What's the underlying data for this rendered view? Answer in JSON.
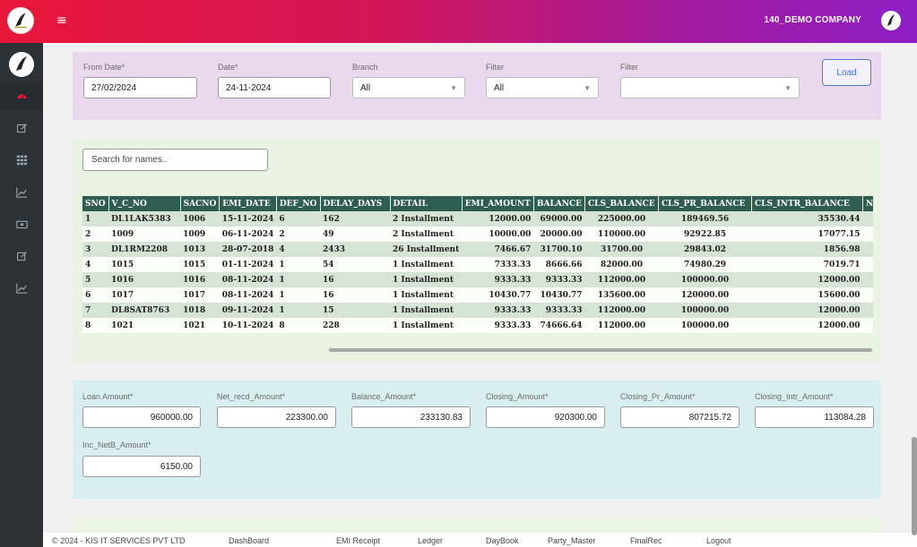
{
  "header": {
    "company": "140_DEMO COMPANY",
    "menu_icon": "menu-icon",
    "brand_colors": {
      "start": "#e8173a",
      "end": "#8e1fc4"
    }
  },
  "sidebar": {
    "items": [
      {
        "icon": "dashboard-icon",
        "active": true
      },
      {
        "icon": "edit-icon",
        "active": false
      },
      {
        "icon": "grid-icon",
        "active": false
      },
      {
        "icon": "chart-icon",
        "active": false
      },
      {
        "icon": "money-icon",
        "active": false
      },
      {
        "icon": "edit-icon",
        "active": false
      },
      {
        "icon": "chart-icon",
        "active": false
      }
    ]
  },
  "filters": {
    "from_date_label": "From Date*",
    "from_date_value": "27/02/2024",
    "date_label": "Date*",
    "date_value": "24-11-2024",
    "branch_label": "Branch",
    "branch_value": "All",
    "filter1_label": "Filter",
    "filter1_value": "All",
    "filter2_label": "Filter",
    "filter2_value": "",
    "load_label": "Load"
  },
  "search": {
    "placeholder": "Search for names.."
  },
  "table": {
    "columns": [
      "SNO",
      "V_C_NO",
      "SACNO",
      "EMI_DATE",
      "DEF_NO",
      "DELAY_DAYS",
      "DETAIL",
      "EMI_AMOUNT",
      "BALANCE",
      "CLS_BALANCE",
      "CLS_PR_BALANCE",
      "CLS_INTR_BALANCE",
      "N"
    ],
    "rows": [
      [
        "1",
        "DL1LAK5383",
        "1006",
        "15-11-2024",
        "6",
        "162",
        "2 Installment",
        "12000.00",
        "69000.00",
        "225000.00",
        "189469.56",
        "35530.44",
        ""
      ],
      [
        "2",
        "1009",
        "1009",
        "06-11-2024",
        "2",
        "49",
        "2 Installment",
        "10000.00",
        "20000.00",
        "110000.00",
        "92922.85",
        "17077.15",
        ""
      ],
      [
        "3",
        "DL1RM2208",
        "1013",
        "28-07-2018",
        "4",
        "2433",
        "26 Installment",
        "7466.67",
        "31700.10",
        "31700.00",
        "29843.02",
        "1856.98",
        ""
      ],
      [
        "4",
        "1015",
        "1015",
        "01-11-2024",
        "1",
        "54",
        "1 Installment",
        "7333.33",
        "8666.66",
        "82000.00",
        "74980.29",
        "7019.71",
        ""
      ],
      [
        "5",
        "1016",
        "1016",
        "08-11-2024",
        "1",
        "16",
        "1 Installment",
        "9333.33",
        "9333.33",
        "112000.00",
        "100000.00",
        "12000.00",
        ""
      ],
      [
        "6",
        "1017",
        "1017",
        "08-11-2024",
        "1",
        "16",
        "1 Installment",
        "10430.77",
        "10430.77",
        "135600.00",
        "120000.00",
        "15600.00",
        ""
      ],
      [
        "7",
        "DL8SAT8763",
        "1018",
        "09-11-2024",
        "1",
        "15",
        "1 Installment",
        "9333.33",
        "9333.33",
        "112000.00",
        "100000.00",
        "12000.00",
        ""
      ],
      [
        "8",
        "1021",
        "1021",
        "10-11-2024",
        "8",
        "228",
        "1 Installment",
        "9333.33",
        "74666.64",
        "112000.00",
        "100000.00",
        "12000.00",
        ""
      ]
    ]
  },
  "summary": {
    "loan_amount_label": "Loan Amount*",
    "loan_amount": "960000.00",
    "net_recd_label": "Net_recd_Amount*",
    "net_recd": "223300.00",
    "balance_label": "Balance_Amount*",
    "balance": "233130.83",
    "closing_label": "Closing_Amount*",
    "closing": "920300.00",
    "closing_pr_label": "Closing_Pr_Amount*",
    "closing_pr": "807215.72",
    "closing_intr_label": "Closing_Intr_Amount*",
    "closing_intr": "113084.28",
    "inc_netb_label": "Inc_NetB_Amount*",
    "inc_netb": "6150.00"
  },
  "footer": {
    "copyright": "© 2024 - KIS IT SERVICES PVT LTD",
    "links": [
      "DashBoard",
      "EMI Receipt",
      "Ledger",
      "DayBook",
      "Party_Master",
      "FinalRec",
      "Logout"
    ]
  }
}
